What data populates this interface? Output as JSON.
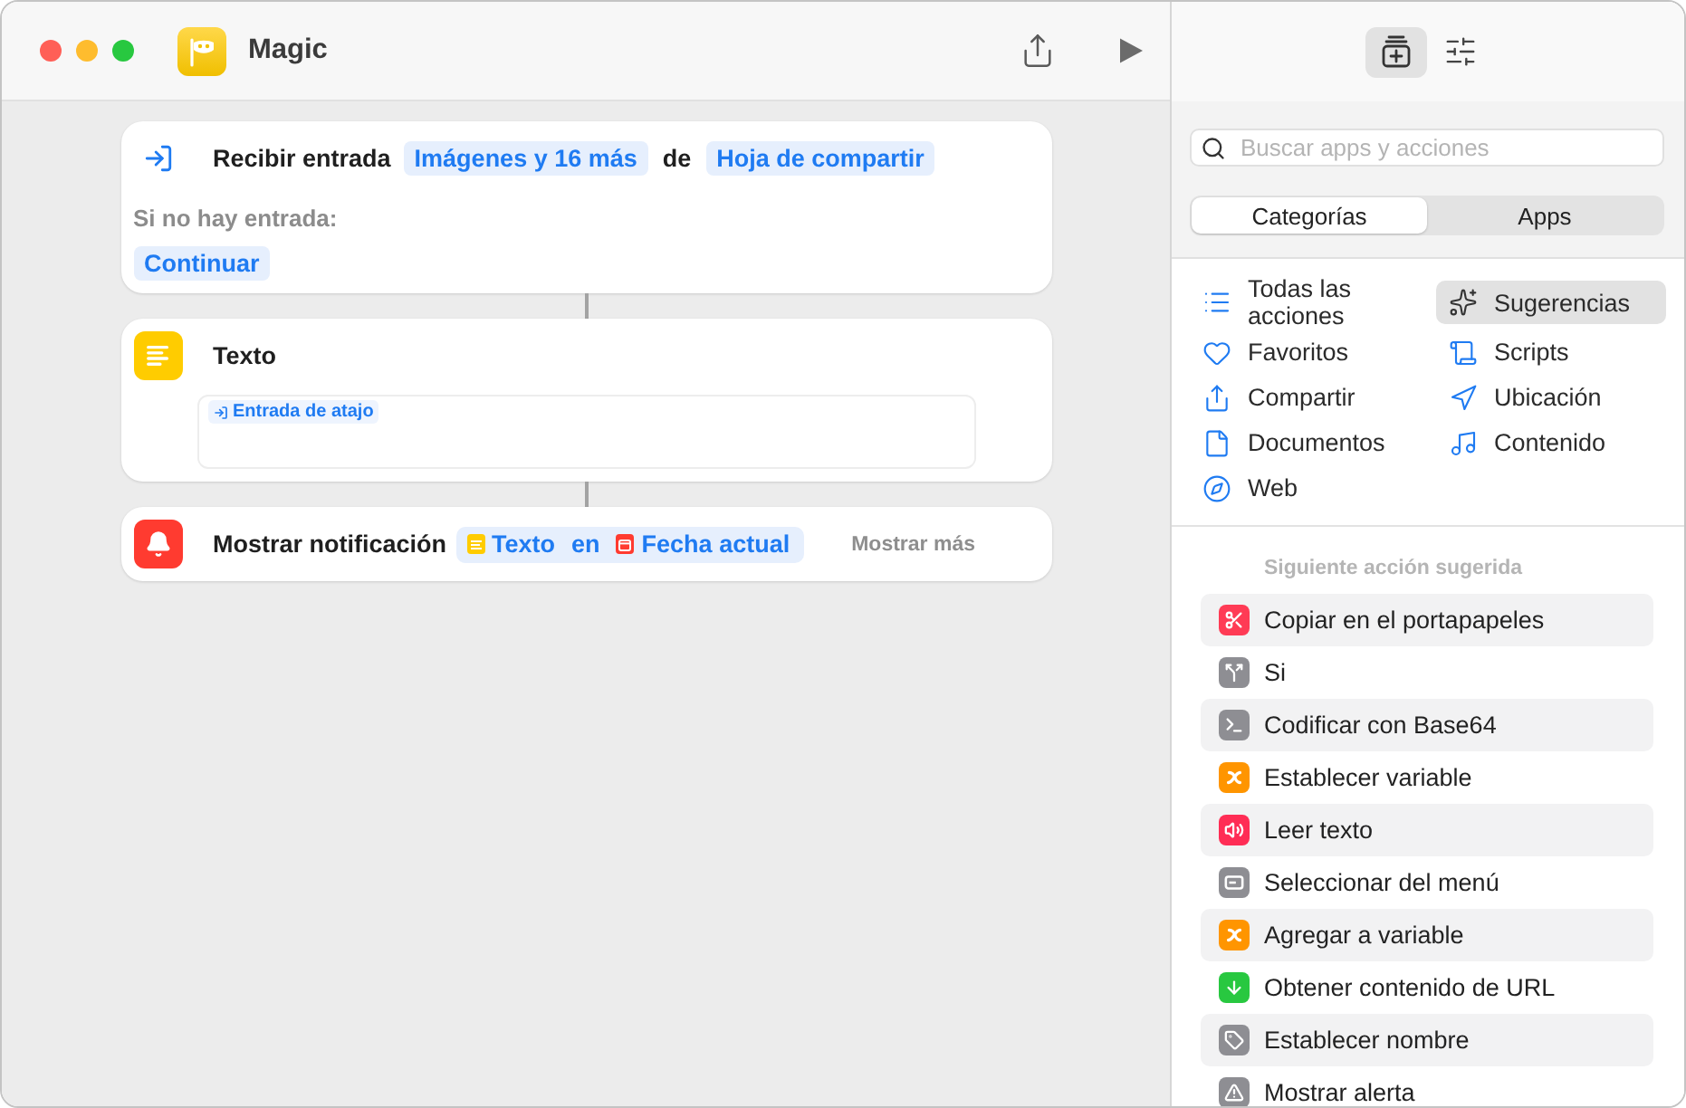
{
  "window": {
    "title": "Magic"
  },
  "actions": [
    {
      "kind": "input",
      "title": "Recibir entrada",
      "params": [
        {
          "kind": "token",
          "text": "Imágenes y 16 más"
        },
        {
          "kind": "word",
          "text": "de"
        },
        {
          "kind": "token",
          "text": "Hoja de compartir"
        }
      ],
      "fallback": {
        "label": "Si no hay entrada:",
        "token": "Continuar"
      }
    },
    {
      "kind": "text",
      "title": "Texto",
      "body": {
        "tokens": [
          "Entrada de atajo"
        ]
      }
    },
    {
      "kind": "notification",
      "title": "Mostrar notificación",
      "params": [
        {
          "kind": "group",
          "items": [
            {
              "kind": "variable",
              "text": "Texto",
              "color": "#ffcc00"
            },
            {
              "kind": "word",
              "text": "en"
            },
            {
              "kind": "variable",
              "text": "Fecha actual",
              "color": "#ff3b30"
            }
          ]
        }
      ],
      "more": "Mostrar más"
    }
  ],
  "library_toolbar": {
    "buttons": [
      {
        "selected": true
      },
      {
        "selected": false
      }
    ]
  },
  "search": {
    "placeholder": "Buscar apps y acciones"
  },
  "segments": [
    {
      "label": "Categorías",
      "selected": true
    },
    {
      "label": "Apps",
      "selected": false
    }
  ],
  "categories": [
    {
      "label": "Todas las acciones",
      "selected": false
    },
    {
      "label": "Sugerencias",
      "selected": true
    },
    {
      "label": "Favoritos",
      "selected": false
    },
    {
      "label": "Scripts",
      "selected": false
    },
    {
      "label": "Compartir",
      "selected": false
    },
    {
      "label": "Ubicación",
      "selected": false
    },
    {
      "label": "Documentos",
      "selected": false
    },
    {
      "label": "Contenido",
      "selected": false
    },
    {
      "label": "Web",
      "selected": false
    }
  ],
  "suggestions": {
    "heading": "Siguiente acción sugerida",
    "items": [
      {
        "label": "Copiar en el portapapeles",
        "color": "#ff3b55"
      },
      {
        "label": "Si",
        "color": "#8e8e93"
      },
      {
        "label": "Codificar con Base64",
        "color": "#8e8e93"
      },
      {
        "label": "Establecer variable",
        "color": "#ff9500"
      },
      {
        "label": "Leer texto",
        "color": "#ff2d55"
      },
      {
        "label": "Seleccionar del menú",
        "color": "#8e8e93"
      },
      {
        "label": "Agregar a variable",
        "color": "#ff9500"
      },
      {
        "label": "Obtener contenido de URL",
        "color": "#28c840"
      },
      {
        "label": "Establecer nombre",
        "color": "#8e8e93"
      },
      {
        "label": "Mostrar alerta",
        "color": "#8e8e93"
      }
    ]
  }
}
